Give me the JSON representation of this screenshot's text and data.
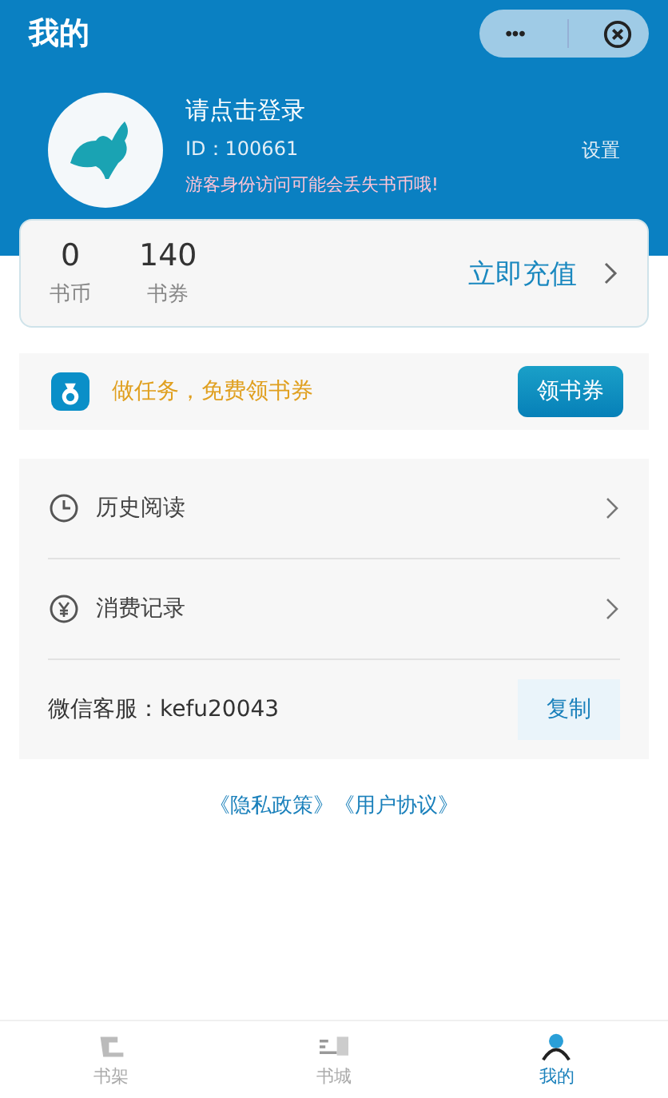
{
  "header": {
    "title": "我的",
    "more": "•••"
  },
  "profile": {
    "login": "请点击登录",
    "id": "ID：100661",
    "warning": "游客身份访问可能会丢失书币哦!",
    "settings": "设置"
  },
  "wallet": {
    "stats": [
      {
        "value": "0",
        "label": "书币"
      },
      {
        "value": "140",
        "label": "书券"
      }
    ],
    "recharge": "立即充值"
  },
  "task": {
    "text": "做任务，免费领书券",
    "button": "领书券"
  },
  "menu": [
    {
      "kind": "link",
      "label": "历史阅读"
    },
    {
      "kind": "link",
      "label": "消费记录"
    },
    {
      "kind": "contact",
      "label": "微信客服：kefu20043",
      "button": "复制"
    }
  ],
  "links": [
    "《隐私政策》",
    "《用户协议》"
  ],
  "tabs": [
    {
      "label": "书架",
      "selected": false
    },
    {
      "label": "书城",
      "selected": false
    },
    {
      "label": "我的",
      "selected": true
    }
  ]
}
